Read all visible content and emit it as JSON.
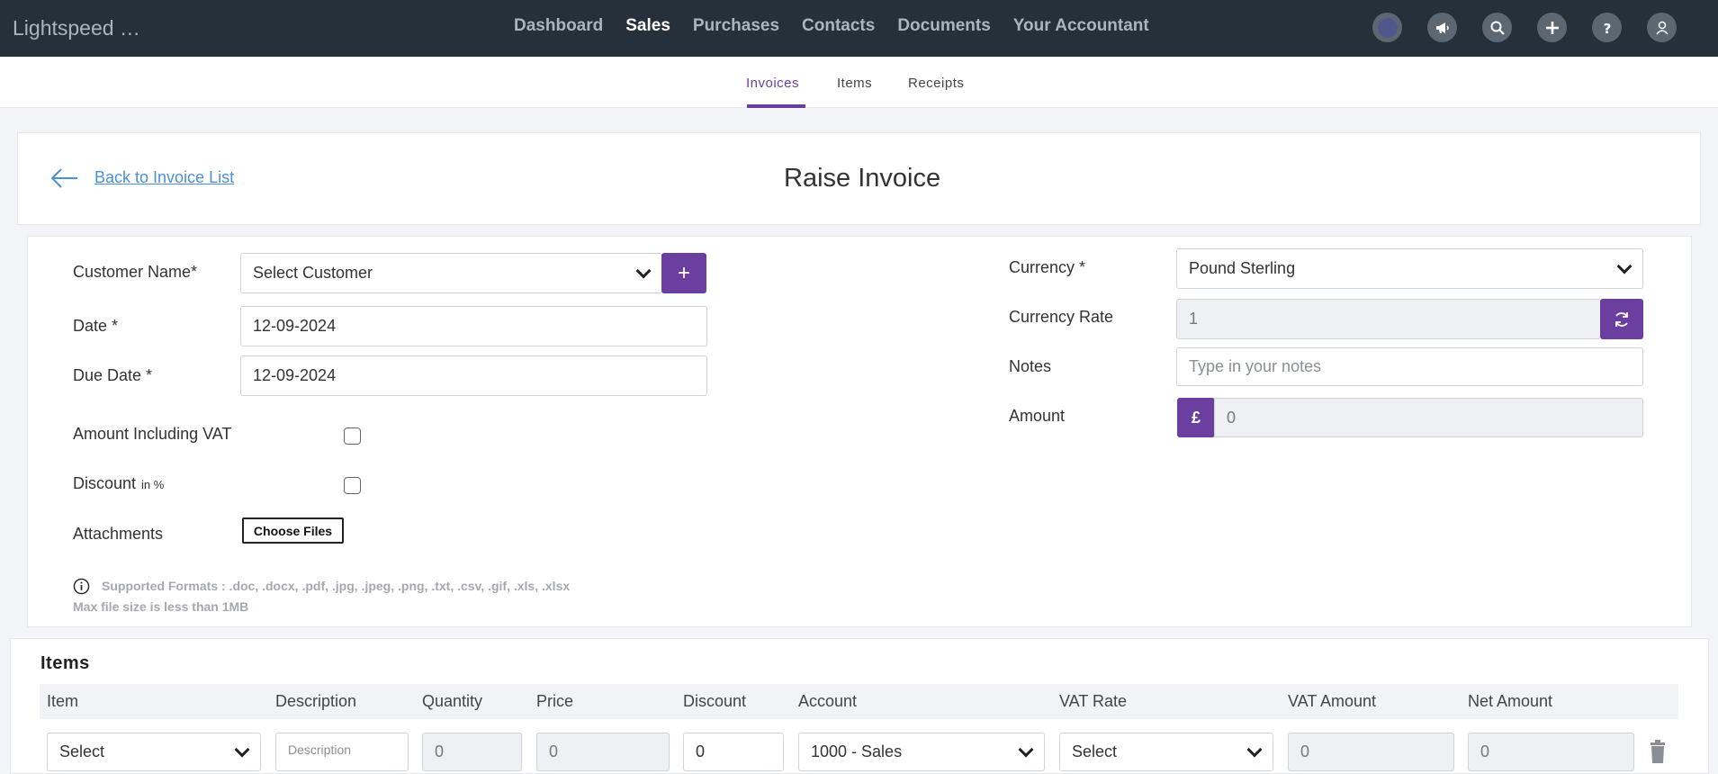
{
  "header": {
    "brand": "Lightspeed …",
    "nav": [
      "Dashboard",
      "Sales",
      "Purchases",
      "Contacts",
      "Documents",
      "Your Accountant"
    ],
    "active_nav": "Sales",
    "icons": [
      "user-circle-icon",
      "megaphone-icon",
      "search-icon",
      "plus-icon",
      "help-icon",
      "profile-icon"
    ]
  },
  "subnav": {
    "tabs": [
      "Invoices",
      "Items",
      "Receipts"
    ],
    "active": "Invoices"
  },
  "page": {
    "back_label": "Back to Invoice List",
    "title": "Raise Invoice"
  },
  "form": {
    "customer_label": "Customer Name*",
    "customer_value": "Select Customer",
    "add_customer": "+",
    "date_label": "Date *",
    "date_value": "12-09-2024",
    "due_label": "Due Date *",
    "due_value": "12-09-2024",
    "vat_label": "Amount Including VAT",
    "discount_label": "Discount",
    "discount_unit": "in %",
    "attachments_label": "Attachments",
    "choose_files": "Choose Files",
    "formats": "Supported Formats : .doc, .docx, .pdf, .jpg, .jpeg, .png, .txt, .csv, .gif, .xls, .xlsx",
    "maxsize": "Max file size is less than 1MB",
    "currency_label": "Currency *",
    "currency_value": "Pound Sterling",
    "rate_label": "Currency Rate",
    "rate_value": "1",
    "notes_label": "Notes",
    "notes_placeholder": "Type in your notes",
    "amount_label": "Amount",
    "amount_symbol": "£",
    "amount_value": "0"
  },
  "items": {
    "title": "Items",
    "columns": [
      "Item",
      "Description",
      "Quantity",
      "Price",
      "Discount",
      "Account",
      "VAT Rate",
      "VAT Amount",
      "Net Amount"
    ],
    "row": {
      "item": "Select",
      "description_placeholder": "Description",
      "quantity": "0",
      "price": "0",
      "discount": "0",
      "account": "1000 - Sales",
      "vat_rate": "Select",
      "vat_amount": "0",
      "net_amount": "0"
    }
  },
  "colors": {
    "topbar": "#25303b",
    "accent": "#6b3fa0",
    "link": "#4a90d9"
  }
}
